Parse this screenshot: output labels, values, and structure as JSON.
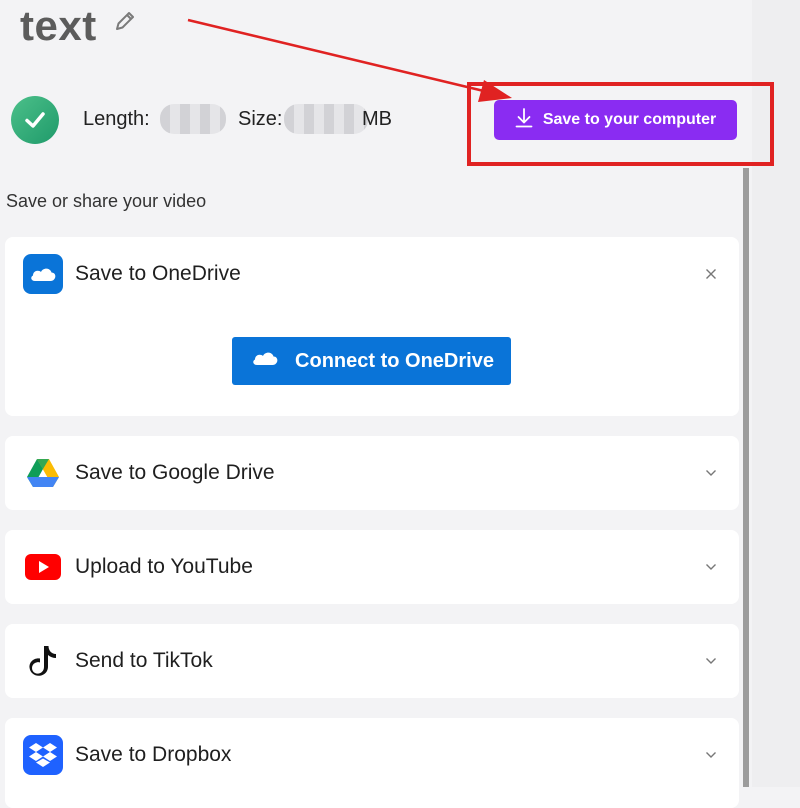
{
  "header": {
    "title": "text",
    "edit_icon": "pencil-icon"
  },
  "summary": {
    "status_icon": "check-circle-icon",
    "length_label": "Length:",
    "size_label": "Size:",
    "size_unit": "MB"
  },
  "actions": {
    "save_computer_label": "Save to your computer",
    "save_computer_icon": "download-icon"
  },
  "section": {
    "label": "Save or share your video"
  },
  "destinations": [
    {
      "title": "Save to OneDrive",
      "icon": "onedrive-icon",
      "expanded": true,
      "connect_label": "Connect to OneDrive"
    },
    {
      "title": "Save to Google Drive",
      "icon": "google-drive-icon",
      "expanded": false
    },
    {
      "title": "Upload to YouTube",
      "icon": "youtube-icon",
      "expanded": false
    },
    {
      "title": "Send to TikTok",
      "icon": "tiktok-icon",
      "expanded": false
    },
    {
      "title": "Save to Dropbox",
      "icon": "dropbox-icon",
      "expanded": false
    }
  ],
  "colors": {
    "primary_purple": "#8a2cf2",
    "onedrive_blue": "#0a74d8",
    "annotation_red": "#e02222",
    "success_green": "#2bb07a"
  }
}
